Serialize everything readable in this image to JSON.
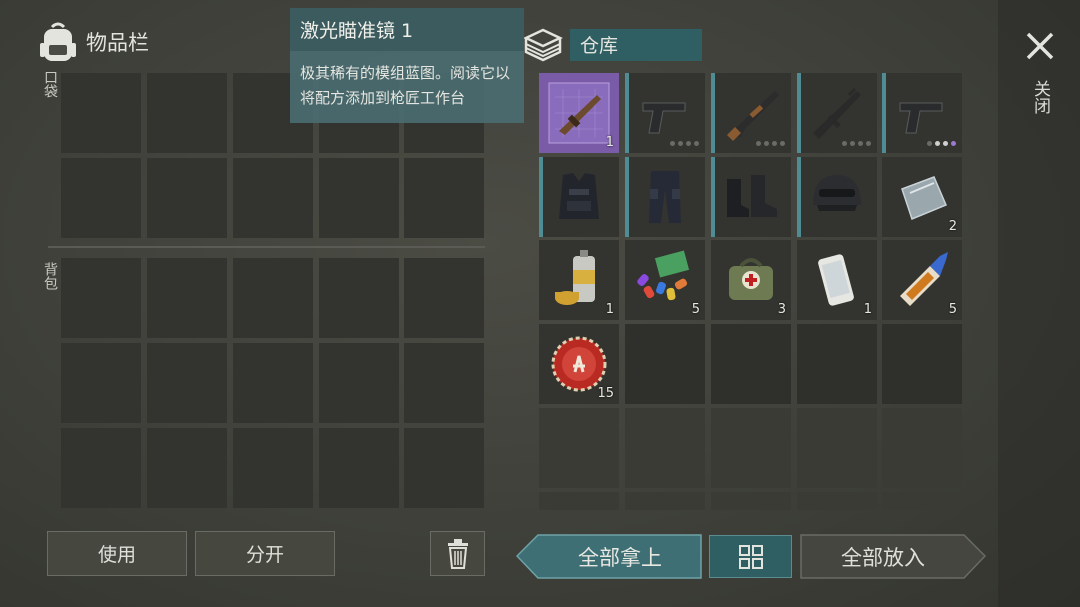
{
  "inventory": {
    "title": "物品栏",
    "pocket_label": "口袋",
    "backpack_label": "背包"
  },
  "warehouse": {
    "title": "仓库",
    "items": [
      {
        "name": "blueprint-laser-sight",
        "count": "1"
      },
      {
        "name": "pistol",
        "dots": 4
      },
      {
        "name": "shotgun",
        "dots": 4
      },
      {
        "name": "assault-rifle",
        "dots": 4
      },
      {
        "name": "pistol-rare",
        "dots": 4
      },
      {
        "name": "police-vest",
        "count": ""
      },
      {
        "name": "police-pants",
        "count": ""
      },
      {
        "name": "police-boots",
        "count": ""
      },
      {
        "name": "police-helmet",
        "count": ""
      },
      {
        "name": "metal-plate",
        "count": "2"
      },
      {
        "name": "spray-can",
        "count": "1"
      },
      {
        "name": "gun-parts",
        "count": "5"
      },
      {
        "name": "first-aid-bag",
        "count": "3"
      },
      {
        "name": "smartphone",
        "count": "1"
      },
      {
        "name": "glue",
        "count": "5"
      },
      {
        "name": "bottle-cap",
        "count": "15"
      }
    ]
  },
  "tooltip": {
    "title": "激光瞄准镜 1",
    "description": "极其稀有的模组蓝图。阅读它以将配方添加到枪匠工作台"
  },
  "close": {
    "label": "关闭"
  },
  "buttons": {
    "use": "使用",
    "split": "分开",
    "take_all": "全部拿上",
    "put_all": "全部放入"
  },
  "colors": {
    "accent": "#4f8c93",
    "panel": "#2f5f63",
    "slot": "#33342f",
    "rare": "#7a5ba8"
  }
}
